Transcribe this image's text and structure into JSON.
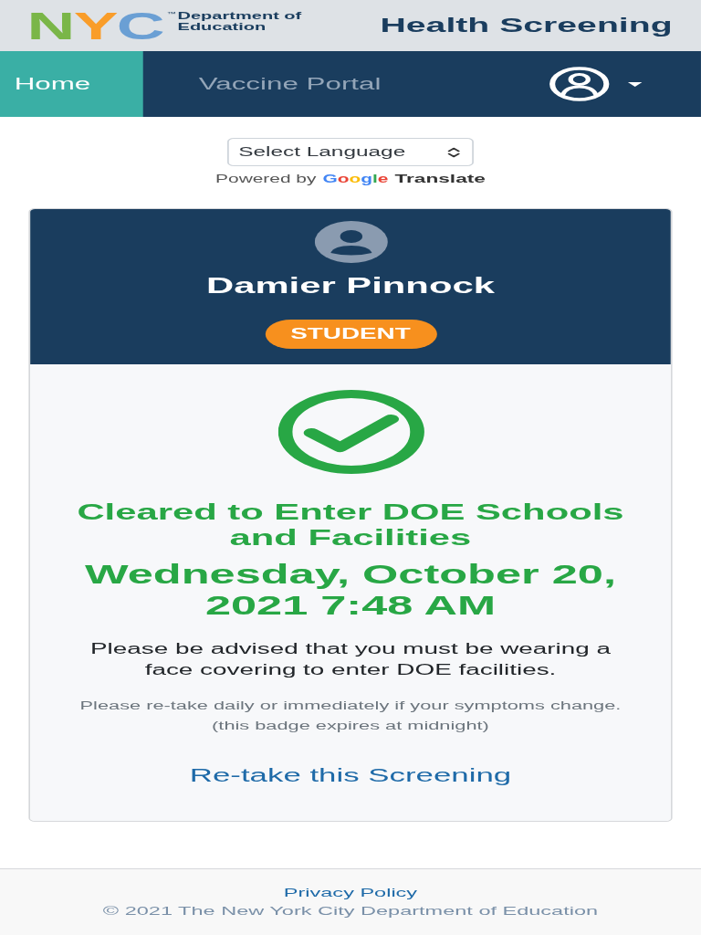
{
  "header": {
    "logo": {
      "letters": "NYC",
      "trademark": "™",
      "agency": [
        "Department of",
        "Education"
      ]
    },
    "title": "Health Screening"
  },
  "nav": {
    "tabs": [
      {
        "label": "Home",
        "selected": true
      },
      {
        "label": "Vaccine Portal",
        "selected": false
      }
    ]
  },
  "language": {
    "select": {
      "value": "Select Language"
    },
    "powered_by": "Powered by",
    "brand": "Google",
    "service": "Translate"
  },
  "card": {
    "name": "Damier Pinnock",
    "role": "STUDENT",
    "status": {
      "kind": "cleared",
      "title": "Cleared to Enter DOE Schools and Facilities",
      "timestamp": "Wednesday, October 20, 2021 7:48 AM"
    },
    "advisory": "Please be advised that you must be wearing a face covering to enter DOE facilities.",
    "notes": [
      "Please re-take daily or immediately if your symptoms change.",
      "(this badge expires at midnight)"
    ],
    "retake_link": "Re-take this Screening"
  },
  "footer": {
    "link": "Privacy Policy",
    "copyright": "© 2021 The New York City Department of Education"
  }
}
